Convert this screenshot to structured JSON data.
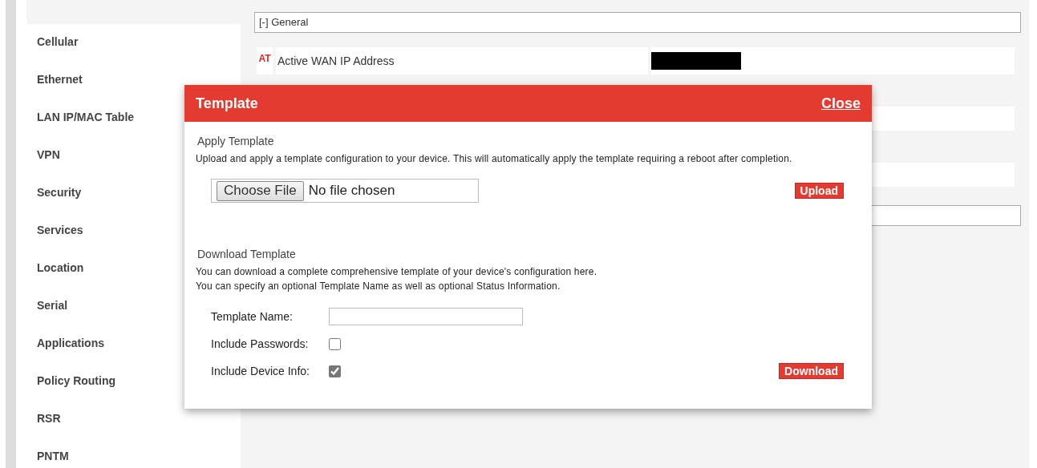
{
  "sidebar": {
    "items": [
      {
        "label": "Cellular"
      },
      {
        "label": "Ethernet"
      },
      {
        "label": "LAN IP/MAC Table"
      },
      {
        "label": "VPN"
      },
      {
        "label": "Security"
      },
      {
        "label": "Services"
      },
      {
        "label": "Location"
      },
      {
        "label": "Serial"
      },
      {
        "label": "Applications"
      },
      {
        "label": "Policy Routing"
      },
      {
        "label": "RSR"
      },
      {
        "label": "PNTM"
      }
    ]
  },
  "general": {
    "toggle": "[-] General",
    "row": {
      "tag": "AT",
      "label": "Active WAN IP Address"
    }
  },
  "modal": {
    "title": "Template",
    "close": "Close",
    "apply": {
      "heading": "Apply Template",
      "description": "Upload and apply a template configuration to your device. This will automatically apply the template requiring a reboot after completion.",
      "file_button": "Choose File",
      "file_status": "No file chosen",
      "upload": "Upload"
    },
    "download": {
      "heading": "Download Template",
      "description_lines": [
        "You can download a complete comprehensive template of your device's configuration here.",
        "You can specify an optional Template Name as well as optional Status Information."
      ],
      "fields": [
        {
          "kind": "text",
          "label": "Template Name:"
        },
        {
          "kind": "checkbox",
          "label": "Include Passwords:",
          "checked": false
        },
        {
          "kind": "checkbox",
          "label": "Include Device Info:",
          "checked": true
        }
      ],
      "download": "Download"
    }
  }
}
